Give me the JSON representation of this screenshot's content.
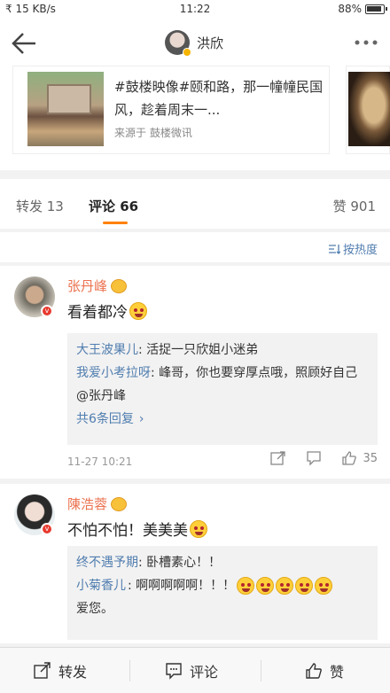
{
  "status": {
    "signal": "₹ 15 KB/s",
    "time": "11:22",
    "battery": "88%"
  },
  "nav": {
    "title": "洪欣"
  },
  "cards": [
    {
      "text": "#鼓楼映像#颐和路，那一幢幢民国风，趁着周末一...",
      "source": "来源于 鼓楼微讯"
    }
  ],
  "tabs": {
    "repost": "转发 13",
    "comments": "评论 66",
    "likes": "赞 901"
  },
  "sort": {
    "label": "按热度"
  },
  "comments": [
    {
      "name": "张丹峰",
      "text": "看着都冷",
      "replies": [
        {
          "name": "大王波果儿",
          "text": ": 活捉一只欣姐小迷弟"
        },
        {
          "name": "我爱小考拉呀",
          "text": ": 峰哥，你也要穿厚点哦，照顾好自己@张丹峰"
        }
      ],
      "more": "共6条回复",
      "time": "11-27 10:21",
      "likes": "35"
    },
    {
      "name": "陳浩蓉",
      "text": "不怕不怕！美美美",
      "replies": [
        {
          "name": "终不遇予期",
          "text": ": 卧槽素心！！"
        },
        {
          "name": "小菊香儿",
          "text": ": 啊啊啊啊啊！！！"
        },
        {
          "name": "",
          "text": "爱您。"
        }
      ]
    }
  ],
  "bottom": {
    "repost": "转发",
    "comment": "评论",
    "like": "赞"
  }
}
